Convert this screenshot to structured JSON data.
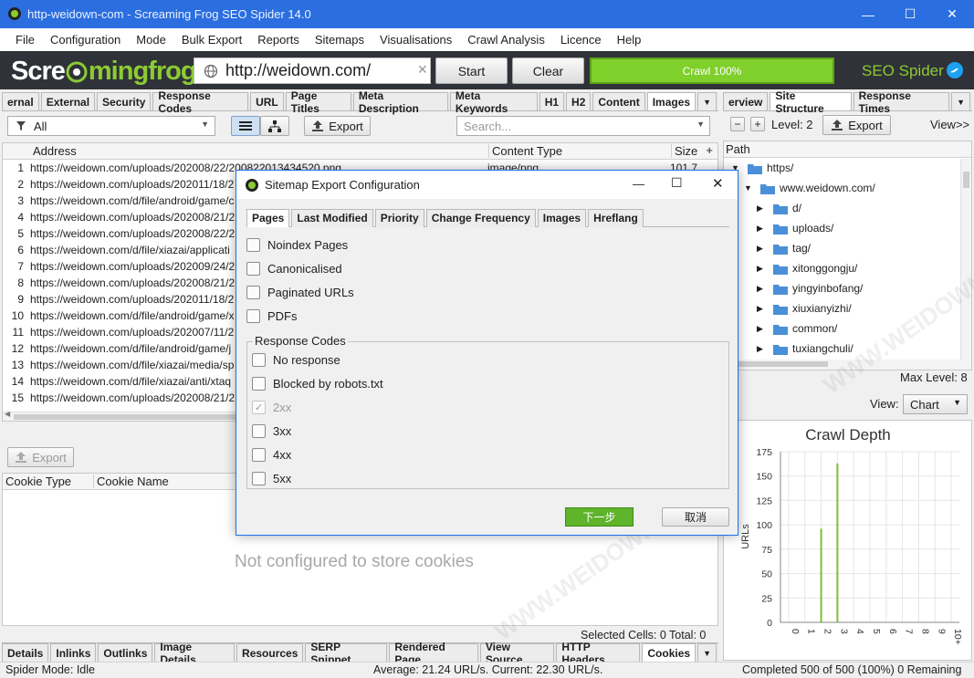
{
  "window": {
    "title": "http-weidown-com - Screaming Frog SEO Spider 14.0",
    "min": "—",
    "max": "☐",
    "close": "✕"
  },
  "menu": [
    "File",
    "Configuration",
    "Mode",
    "Bulk Export",
    "Reports",
    "Sitemaps",
    "Visualisations",
    "Crawl Analysis",
    "Licence",
    "Help"
  ],
  "toolbar": {
    "logo_a": "Scre",
    "logo_b": "mingfrog",
    "url": "http://weidown.com/",
    "start": "Start",
    "clear": "Clear",
    "crawl_status": "Crawl 100%",
    "seo_spider": "SEO Spider"
  },
  "main_tabs": [
    "ernal",
    "External",
    "Security",
    "Response Codes",
    "URL",
    "Page Titles",
    "Meta Description",
    "Meta Keywords",
    "H1",
    "H2",
    "Content",
    "Images"
  ],
  "filter": {
    "selected": "All",
    "export": "Export",
    "search_placeholder": "Search..."
  },
  "grid": {
    "headers": [
      "Address",
      "Content Type",
      "Size"
    ],
    "rows": [
      {
        "n": "1",
        "url": "https://weidown.com/uploads/202008/22/200822013434520.png",
        "type": "image/png",
        "size": "101.7"
      },
      {
        "n": "2",
        "url": "https://weidown.com/uploads/202011/18/2",
        "type": "",
        "size": ""
      },
      {
        "n": "3",
        "url": "https://weidown.com/d/file/android/game/c",
        "type": "",
        "size": ""
      },
      {
        "n": "4",
        "url": "https://weidown.com/uploads/202008/21/2",
        "type": "",
        "size": ""
      },
      {
        "n": "5",
        "url": "https://weidown.com/uploads/202008/22/2",
        "type": "",
        "size": ""
      },
      {
        "n": "6",
        "url": "https://weidown.com/d/file/xiazai/applicati",
        "type": "",
        "size": ""
      },
      {
        "n": "7",
        "url": "https://weidown.com/uploads/202009/24/2",
        "type": "",
        "size": ""
      },
      {
        "n": "8",
        "url": "https://weidown.com/uploads/202008/21/2",
        "type": "",
        "size": ""
      },
      {
        "n": "9",
        "url": "https://weidown.com/uploads/202011/18/2",
        "type": "",
        "size": ""
      },
      {
        "n": "10",
        "url": "https://weidown.com/d/file/android/game/x",
        "type": "",
        "size": ""
      },
      {
        "n": "11",
        "url": "https://weidown.com/uploads/202007/11/2",
        "type": "",
        "size": ""
      },
      {
        "n": "12",
        "url": "https://weidown.com/d/file/android/game/j",
        "type": "",
        "size": ""
      },
      {
        "n": "13",
        "url": "https://weidown.com/d/file/xiazai/media/sp",
        "type": "",
        "size": ""
      },
      {
        "n": "14",
        "url": "https://weidown.com/d/file/xiazai/anti/xtaq",
        "type": "",
        "size": ""
      },
      {
        "n": "15",
        "url": "https://weidown.com/uploads/202008/21/2",
        "type": "",
        "size": ""
      }
    ]
  },
  "lower": {
    "export": "Export",
    "col1": "Cookie Type",
    "col2": "Cookie Name",
    "empty": "Not configured to store cookies",
    "selected_cells": "Selected Cells: 0 Total: 0"
  },
  "bottom_tabs": [
    "Details",
    "Inlinks",
    "Outlinks",
    "Image Details",
    "Resources",
    "SERP Snippet",
    "Rendered Page",
    "View Source",
    "HTTP Headers",
    "Cookies"
  ],
  "status": {
    "mode": "Spider Mode: Idle",
    "average": "Average: 21.24 URL/s. Current: 22.30 URL/s.",
    "completed": "Completed 500 of 500 (100%) 0 Remaining"
  },
  "right": {
    "tabs": [
      "erview",
      "Site Structure",
      "Response Times"
    ],
    "level": "Level: 2",
    "export": "Export",
    "view_label": "View>>",
    "path_header": "Path",
    "tree": [
      {
        "label": "https/",
        "depth": 0,
        "open": true
      },
      {
        "label": "www.weidown.com/",
        "depth": 1,
        "open": true
      },
      {
        "label": "d/",
        "depth": 2,
        "open": false
      },
      {
        "label": "uploads/",
        "depth": 2,
        "open": false
      },
      {
        "label": "tag/",
        "depth": 2,
        "open": false
      },
      {
        "label": "xitonggongju/",
        "depth": 2,
        "open": false
      },
      {
        "label": "yingyinbofang/",
        "depth": 2,
        "open": false
      },
      {
        "label": "xiuxianyizhi/",
        "depth": 2,
        "open": false
      },
      {
        "label": "common/",
        "depth": 2,
        "open": false
      },
      {
        "label": "tuxiangchuli/",
        "depth": 2,
        "open": false
      }
    ],
    "max_level": "Max Level: 8",
    "view": "View:",
    "view_select": "Chart"
  },
  "dialog": {
    "title": "Sitemap Export Configuration",
    "tabs": [
      "Pages",
      "Last Modified",
      "Priority",
      "Change Frequency",
      "Images",
      "Hreflang"
    ],
    "options": [
      "Noindex Pages",
      "Canonicalised",
      "Paginated URLs",
      "PDFs"
    ],
    "group_title": "Response Codes",
    "codes": [
      {
        "label": "No response",
        "checked": false,
        "disabled": false
      },
      {
        "label": "Blocked by robots.txt",
        "checked": false,
        "disabled": false
      },
      {
        "label": "2xx",
        "checked": true,
        "disabled": true
      },
      {
        "label": "3xx",
        "checked": false,
        "disabled": false
      },
      {
        "label": "4xx",
        "checked": false,
        "disabled": false
      },
      {
        "label": "5xx",
        "checked": false,
        "disabled": false
      }
    ],
    "next": "下一步",
    "cancel": "取消"
  },
  "watermark": "WWW.WEIDOWN.COM",
  "chart_data": {
    "type": "bar",
    "title": "Crawl Depth",
    "ylabel": "URLs",
    "xlabel": "",
    "categories": [
      "0",
      "1",
      "2",
      "3",
      "4",
      "5",
      "6",
      "7",
      "8",
      "9",
      "10+"
    ],
    "values": [
      0,
      0,
      96,
      163,
      0,
      0,
      0,
      0,
      0,
      0,
      0
    ],
    "ylim": [
      0,
      175
    ],
    "yticks": [
      0,
      25,
      50,
      75,
      100,
      125,
      150,
      175
    ],
    "color": "#7fbf2a",
    "grid": true
  }
}
